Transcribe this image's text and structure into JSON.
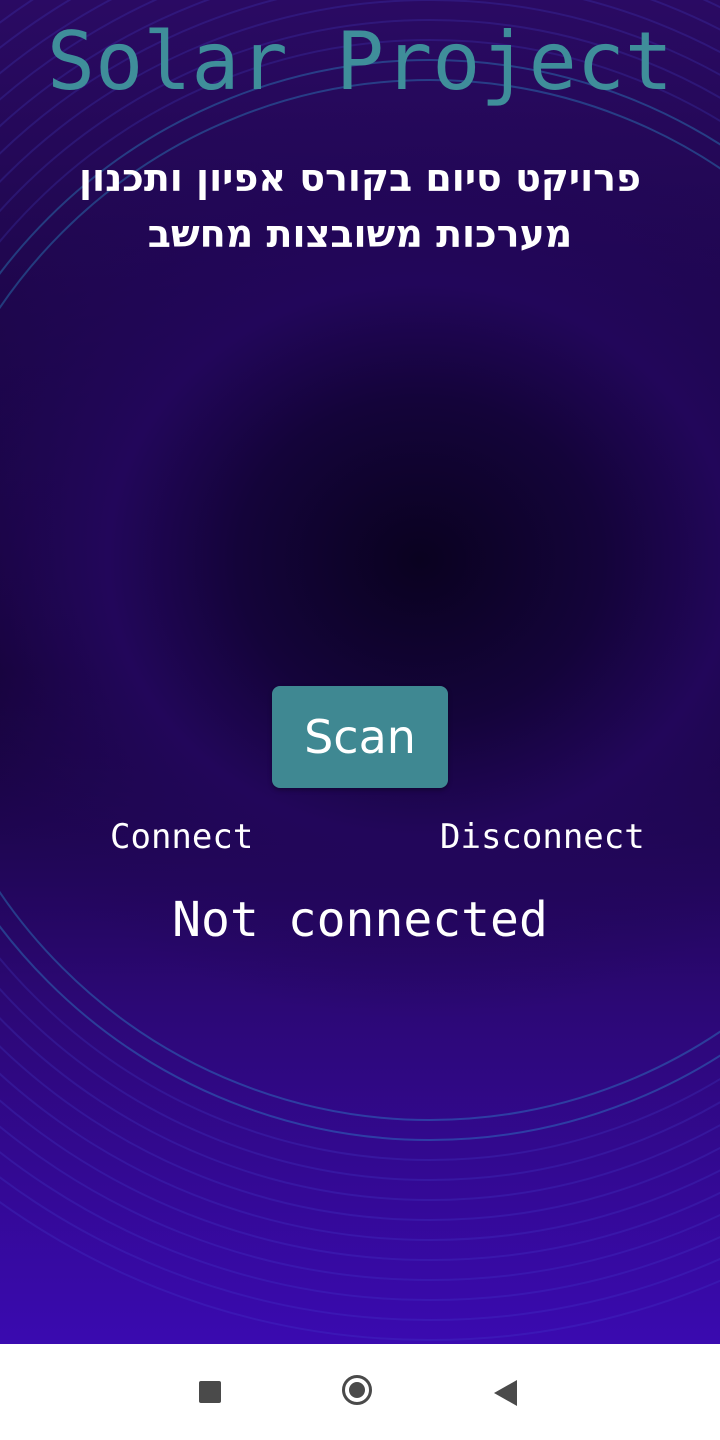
{
  "app": {
    "title": "Solar Project",
    "subtitle": "פרויקט סיום בקורס אפיון ותכנון מערכות משובצות מחשב",
    "scan_label": "Scan",
    "connect_label": "Connect",
    "disconnect_label": "Disconnect",
    "status_text": "Not connected"
  },
  "colors": {
    "title": "#3f8e9a",
    "scan_button": "#3f8892",
    "text": "#ffffff",
    "background_dark": "#12032f",
    "background_purple": "#3a0ab0"
  },
  "navbar": {
    "icons": [
      "recent-apps-icon",
      "home-icon",
      "back-icon"
    ]
  }
}
